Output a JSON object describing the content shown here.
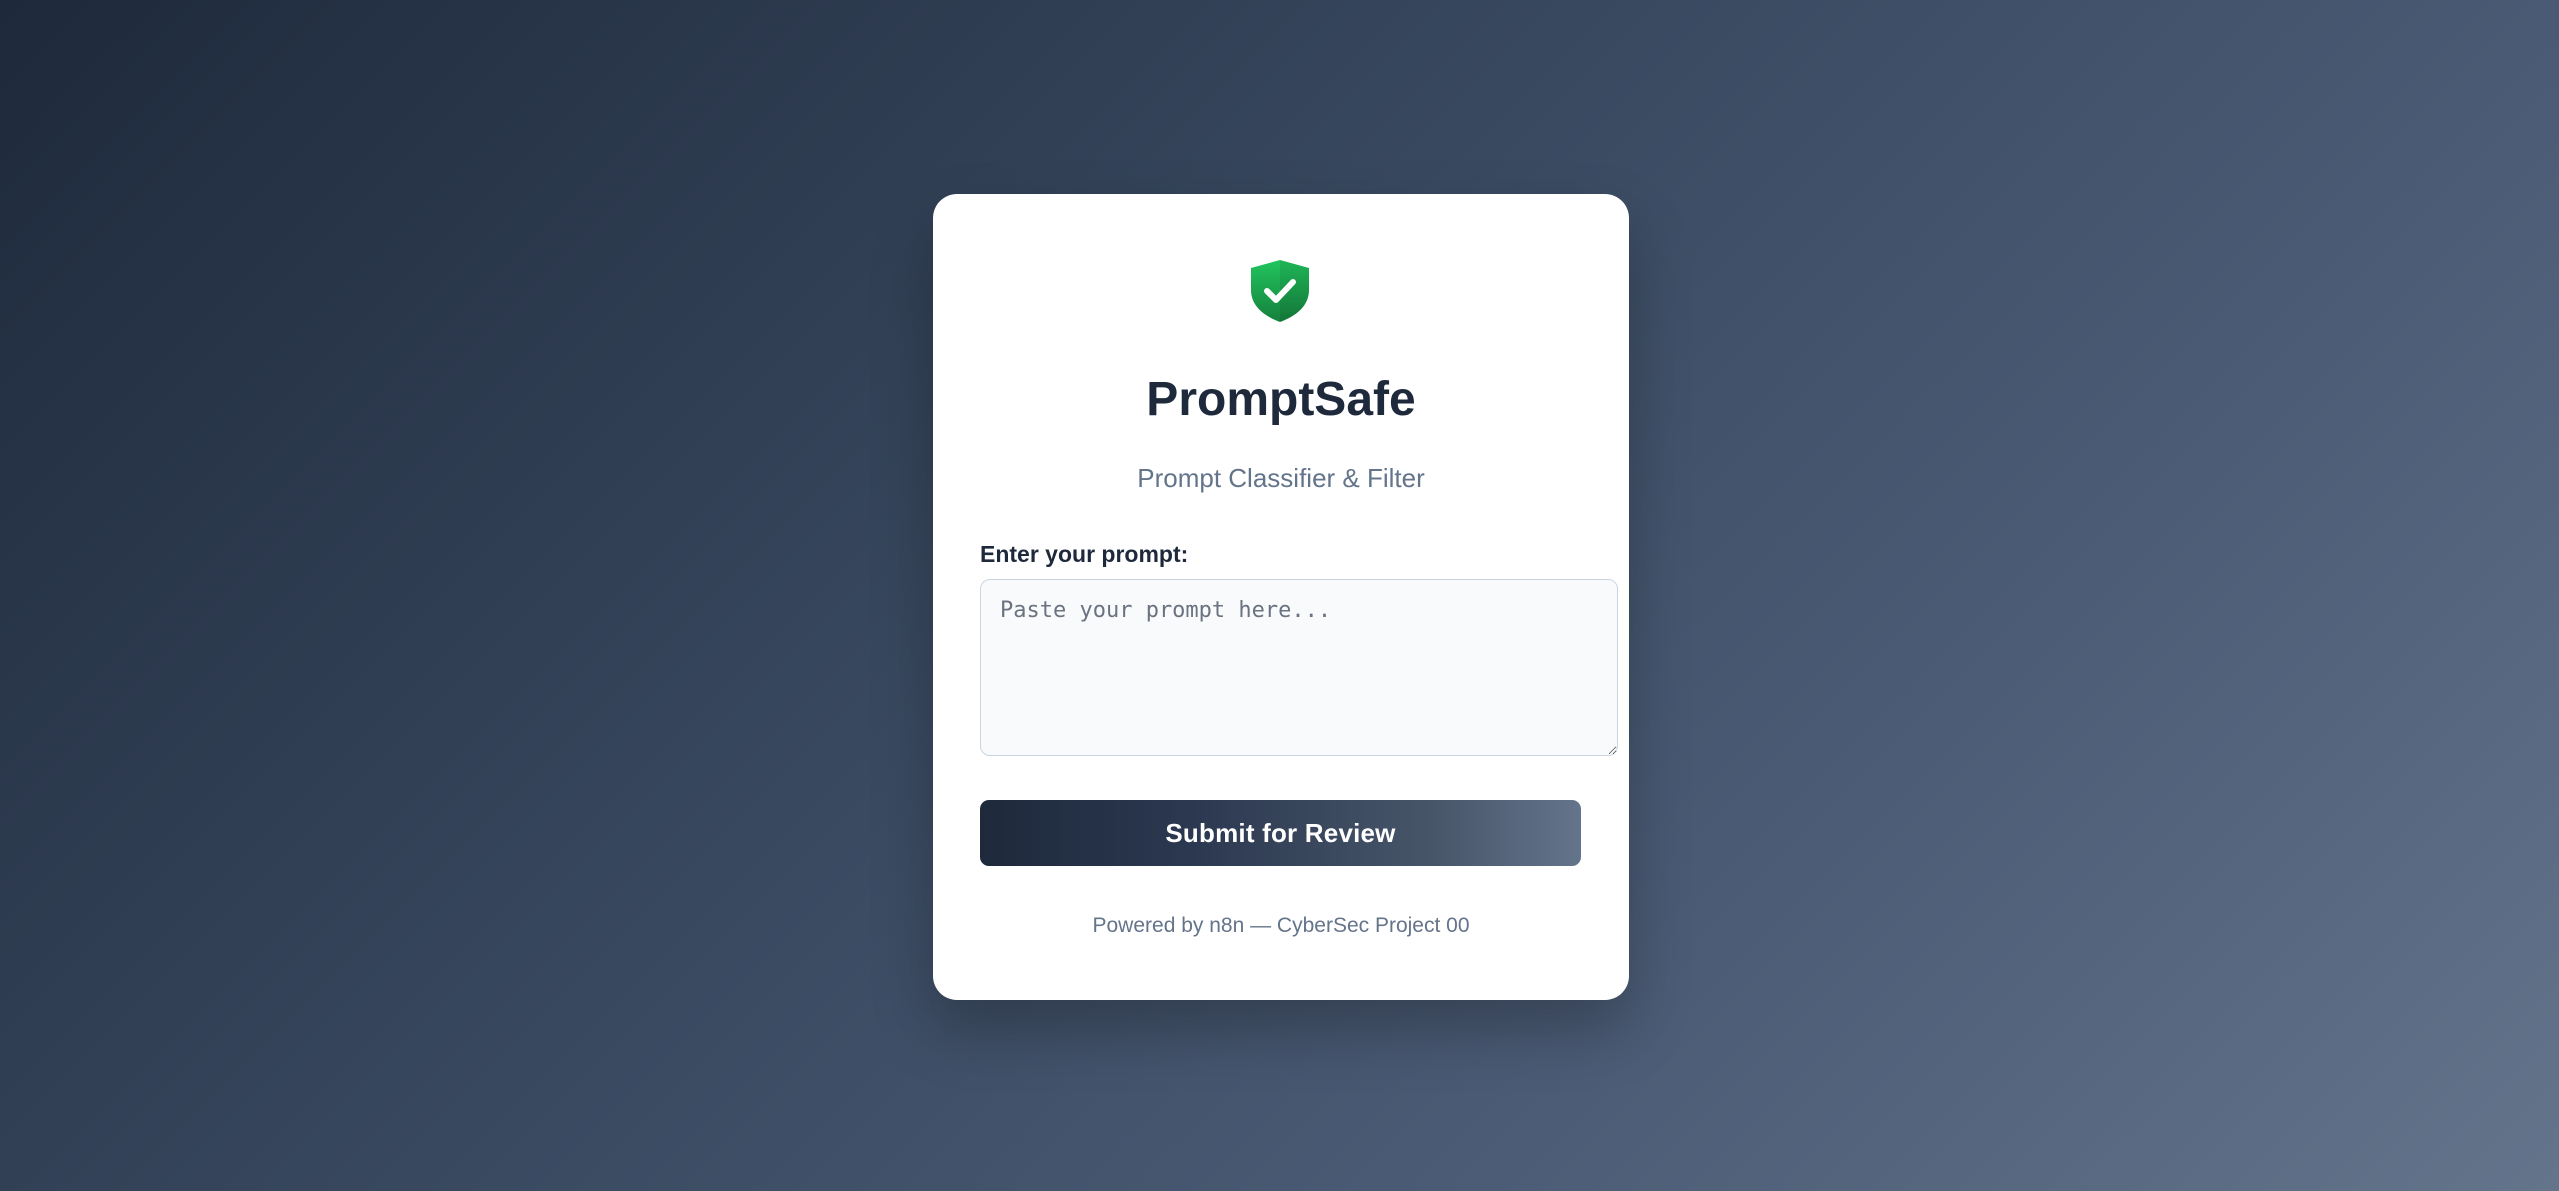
{
  "app": {
    "title": "PromptSafe",
    "subtitle": "Prompt Classifier & Filter",
    "logo_icon": "shield-check-icon",
    "logo_colors": {
      "top": "#22c55e",
      "bottom": "#15803d"
    }
  },
  "form": {
    "prompt_label": "Enter your prompt:",
    "prompt_value": "",
    "prompt_placeholder": "Paste your prompt here...",
    "submit_label": "Submit for Review"
  },
  "footer": {
    "text": "Powered by n8n — CyberSec Project 00"
  },
  "colors": {
    "heading": "#1e293b",
    "muted": "#64748b",
    "button_start": "#1e293b",
    "button_end": "#64748b"
  }
}
